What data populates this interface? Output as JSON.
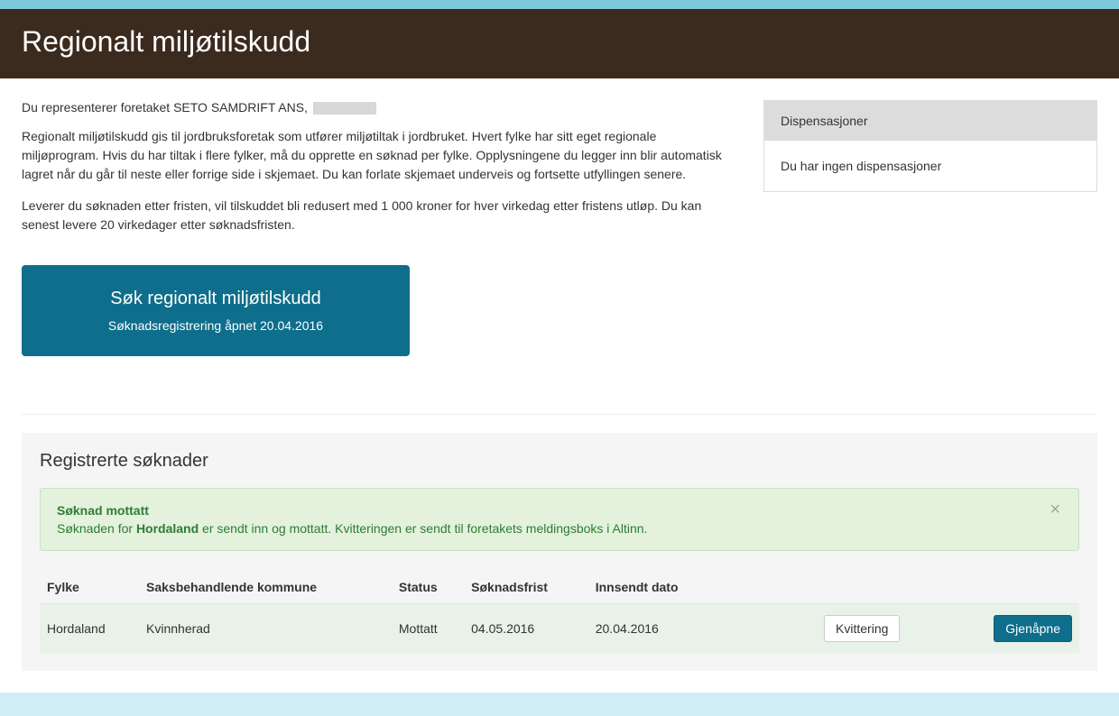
{
  "header": {
    "title": "Regionalt miljøtilskudd"
  },
  "intro": {
    "represent_prefix": "Du representerer foretaket SETO SAMDRIFT ANS,",
    "p1": "Regionalt miljøtilskudd gis til jordbruksforetak som utfører miljøtiltak i jordbruket. Hvert fylke har sitt eget regionale miljøprogram. Hvis du har tiltak i flere fylker, må du opprette en søknad per fylke. Opplysningene du legger inn blir automatisk lagret når du går til neste eller forrige side i skjemaet. Du kan forlate skjemaet underveis og fortsette utfyllingen senere.",
    "p2": "Leverer du søknaden etter fristen, vil tilskuddet bli redusert med 1 000 kroner for hver virkedag etter fristens utløp. Du kan senest levere 20 virkedager etter søknadsfristen."
  },
  "cta": {
    "title": "Søk regionalt miljøtilskudd",
    "sub": "Søknadsregistrering åpnet 20.04.2016"
  },
  "side": {
    "title": "Dispensasjoner",
    "body": "Du har ingen dispensasjoner"
  },
  "registered": {
    "heading": "Registrerte søknader",
    "alert": {
      "title": "Søknad mottatt",
      "pre": "Søknaden for ",
      "bold": "Hordaland",
      "post": " er sendt inn og mottatt. Kvitteringen er sendt til foretakets meldingsboks i Altinn."
    },
    "columns": {
      "fylke": "Fylke",
      "kommune": "Saksbehandlende kommune",
      "status": "Status",
      "frist": "Søknadsfrist",
      "innsendt": "Innsendt dato"
    },
    "rows": [
      {
        "fylke": "Hordaland",
        "kommune": "Kvinnherad",
        "status": "Mottatt",
        "frist": "04.05.2016",
        "innsendt": "20.04.2016"
      }
    ],
    "buttons": {
      "kvittering": "Kvittering",
      "gjenapne": "Gjenåpne"
    }
  }
}
